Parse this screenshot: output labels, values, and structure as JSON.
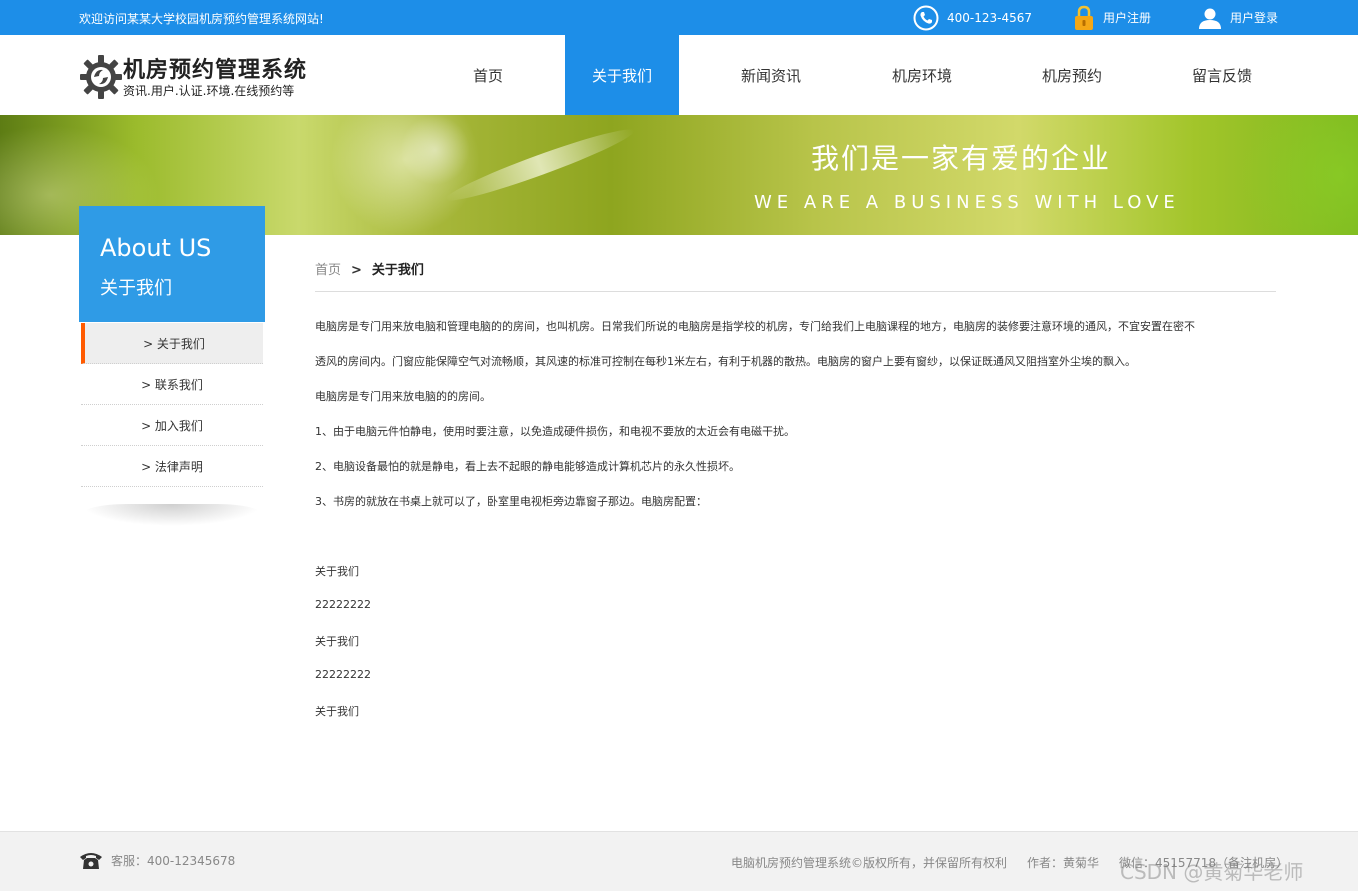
{
  "topbar": {
    "welcome": "欢迎访问某某大学校园机房预约管理系统网站!",
    "phone": "400-123-4567",
    "register": "用户注册",
    "login": "用户登录"
  },
  "logo": {
    "title": "机房预约管理系统",
    "subtitle": "资讯.用户.认证.环境.在线预约等"
  },
  "nav": [
    {
      "label": "首页"
    },
    {
      "label": "关于我们"
    },
    {
      "label": "新闻资讯"
    },
    {
      "label": "机房环境"
    },
    {
      "label": "机房预约"
    },
    {
      "label": "留言反馈"
    }
  ],
  "nav_active_index": 1,
  "banner": {
    "cn": "我们是一家有爱的企业",
    "en": "WE ARE A BUSINESS WITH LOVE"
  },
  "sidebar": {
    "title_en": "About US",
    "title_cn": "关于我们",
    "items": [
      {
        "label": "> 关于我们"
      },
      {
        "label": "> 联系我们"
      },
      {
        "label": "> 加入我们"
      },
      {
        "label": "> 法律声明"
      }
    ],
    "active_index": 0
  },
  "breadcrumb": {
    "home": "首页",
    "sep": ">",
    "current": "关于我们"
  },
  "content": {
    "paragraphs": [
      "电脑房是专门用来放电脑和管理电脑的的房间，也叫机房。日常我们所说的电脑房是指学校的机房，专门给我们上电脑课程的地方，电脑房的装修要注意环境的通风，不宜安置在密不",
      "透风的房间内。门窗应能保障空气对流畅顺，其风速的标准可控制在每秒1米左右，有利于机器的散热。电脑房的窗户上要有窗纱，以保证既通风又阻挡室外尘埃的飘入。",
      "电脑房是专门用来放电脑的的房间。",
      "1、由于电脑元件怕静电，使用时要注意，以免造成硬件损伤，和电视不要放的太近会有电磁干扰。",
      "2、电脑设备最怕的就是静电，看上去不起眼的静电能够造成计算机芯片的永久性损坏。",
      "3、书房的就放在书桌上就可以了，卧室里电视柜旁边靠窗子那边。电脑房配置：",
      "关于我们",
      "22222222",
      "关于我们",
      "22222222",
      "关于我们"
    ]
  },
  "footer": {
    "service": "客服：400-12345678",
    "copyright": "电脑机房预约管理系统©版权所有，并保留所有权利",
    "author": "作者：黄菊华",
    "wechat": "微信：45157718（备注机房）"
  },
  "watermark": "CSDN @黄菊华老师",
  "colors": {
    "primary": "#1d8ee8",
    "sidebar_head": "#2f9be6",
    "active_marker": "#ff5a00"
  }
}
